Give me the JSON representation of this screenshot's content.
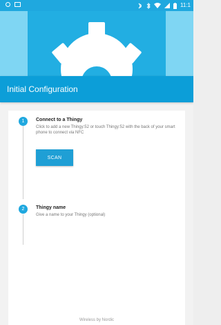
{
  "status_bar": {
    "icons_left": [
      "record-icon",
      "image-icon"
    ],
    "icons_right": [
      "nfc-icon",
      "bluetooth-icon",
      "wifi-icon",
      "signal-icon",
      "battery-icon"
    ],
    "time": "11:1"
  },
  "toolbar": {
    "title": "Initial Configuration"
  },
  "steps": [
    {
      "number": "1",
      "title": "Connect to a Thingy",
      "description": "Click to add a new Thingy:52 or touch Thingy:52 with the back of your smart phone to connect via NFC",
      "button_label": "SCAN"
    },
    {
      "number": "2",
      "title": "Thingy name",
      "description": "Give a name to your Thingy (optional)"
    }
  ],
  "footer": {
    "text": "Wireless by Nordic"
  },
  "colors": {
    "primary": "#1fa8df",
    "toolbar": "#0c9ed8",
    "hero_side": "#7fd6f3",
    "background": "#f2f2f2"
  }
}
